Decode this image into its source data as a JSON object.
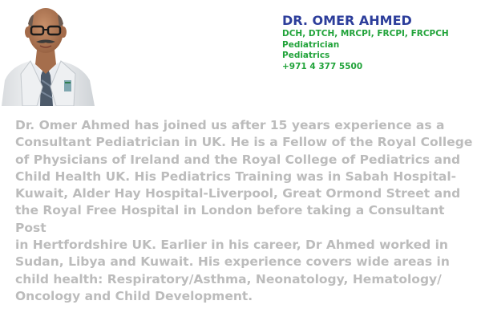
{
  "profile": {
    "name": "DR. OMER AHMED",
    "credentials": "DCH, DTCH, MRCPI, FRCPI, FRCPCH",
    "title": "Pediatrician",
    "department": "Pediatrics",
    "phone": "+971 4 377 5500",
    "photo_icon": "doctor-portrait-icon"
  },
  "bio": {
    "text": "Dr. Omer Ahmed has joined us after 15 years experience as a\nConsultant Pediatrician in UK.  He is a Fellow of the Royal College\nof Physicians of Ireland and the Royal College of Pediatrics and\nChild Health UK.  His Pediatrics Training was in Sabah Hospital-\nKuwait, Alder Hay Hospital-Liverpool, Great Ormond Street and\nthe Royal Free Hospital in London before taking a Consultant Post\nin Hertfordshire UK.  Earlier in his career, Dr Ahmed worked in\nSudan, Libya and Kuwait. His experience covers wide areas in\nchild health: Respiratory/Asthma, Neonatology, Hematology/\nOncology and Child Development."
  },
  "colors": {
    "name": "#2d3e9b",
    "details": "#21a33a",
    "bio_text": "#bcbcbc"
  }
}
